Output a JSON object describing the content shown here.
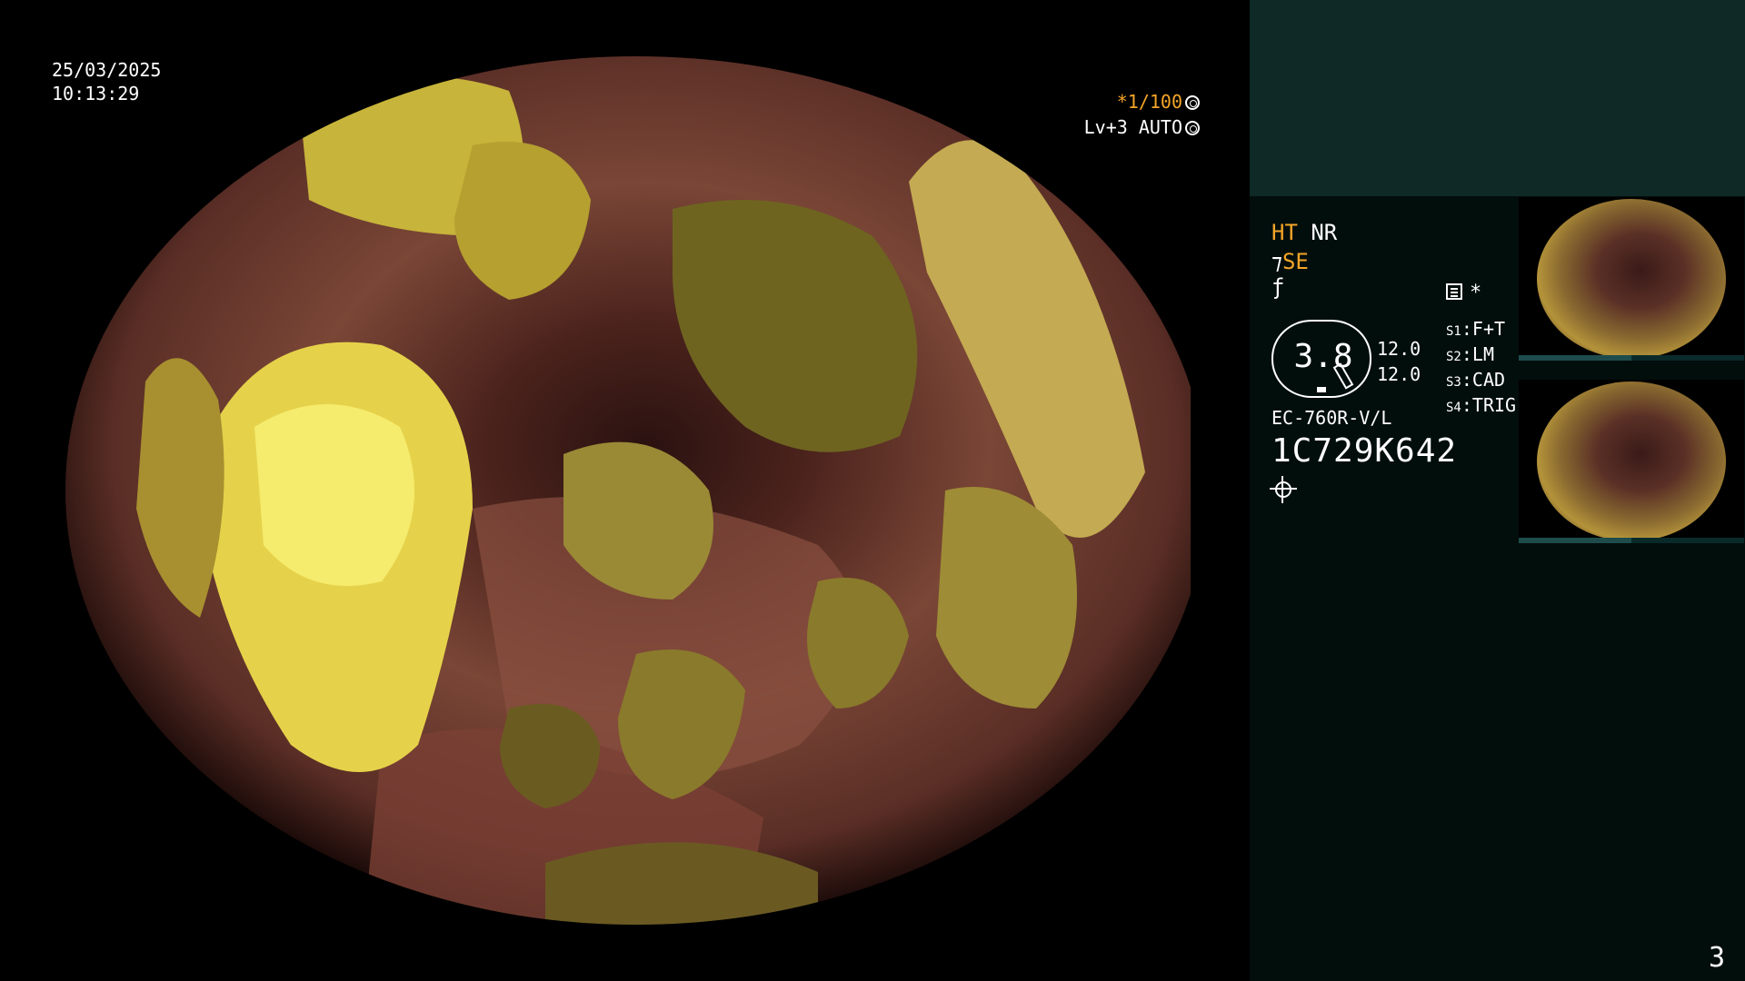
{
  "overlay": {
    "date": "25/03/2025",
    "time": "10:13:29",
    "shutter": "*1/100",
    "level": "Lv+3 AUTO"
  },
  "panel": {
    "ht": "HT",
    "nr": "NR",
    "se": "SE",
    "gauge_value": "3.8",
    "value_top": "12.0",
    "value_bottom": "12.0",
    "switches": [
      {
        "key": "S1",
        "value": "F+T"
      },
      {
        "key": "S2",
        "value": "LM"
      },
      {
        "key": "S3",
        "value": "CAD"
      },
      {
        "key": "S4",
        "value": "TRIG"
      }
    ],
    "scope_model": "EC-760R-V/L",
    "serial": "1C729K642",
    "asterisk": "*"
  },
  "page_number": "3",
  "colors": {
    "accent": "#f4a528",
    "panel_bg": "#020e0c",
    "panel_top_bg": "#0f2927"
  }
}
